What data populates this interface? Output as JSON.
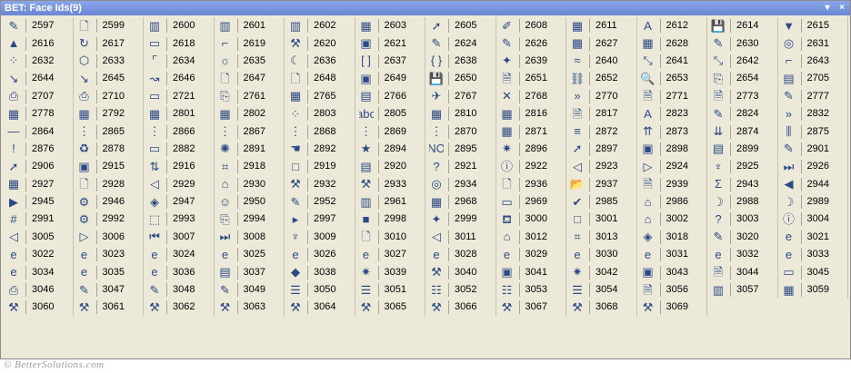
{
  "window": {
    "title": "BET: Face Ids(9)",
    "menu_glyph": "▾",
    "close_glyph": "×"
  },
  "footer": {
    "watermark": "© BetterSolutions.com"
  },
  "colors": {
    "titlebar": "#7a96df",
    "panel": "#ece9d8",
    "text": "#000000"
  },
  "grid": {
    "columns": 12,
    "cells": [
      {
        "id": "2597",
        "icon": "form-check-icon",
        "g": "✎"
      },
      {
        "id": "2599",
        "icon": "blank-page-icon",
        "g": "🗋"
      },
      {
        "id": "2600",
        "icon": "barcode-icon",
        "g": "▥"
      },
      {
        "id": "2601",
        "icon": "barcode2-icon",
        "g": "▥"
      },
      {
        "id": "2602",
        "icon": "barcode3-icon",
        "g": "▥"
      },
      {
        "id": "2603",
        "icon": "picture-icon",
        "g": "▦"
      },
      {
        "id": "2605",
        "icon": "arrow-icon",
        "g": "➚"
      },
      {
        "id": "2608",
        "icon": "tool-icon",
        "g": "✐"
      },
      {
        "id": "2611",
        "icon": "calendar-icon",
        "g": "▦"
      },
      {
        "id": "2612",
        "icon": "font-color-icon",
        "g": "A"
      },
      {
        "id": "2614",
        "icon": "save-icon",
        "g": "💾"
      },
      {
        "id": "2615",
        "icon": "down-arrow-icon",
        "g": "▼"
      },
      {
        "id": "2616",
        "icon": "up-arrow-icon",
        "g": "▲"
      },
      {
        "id": "2617",
        "icon": "rotate-icon",
        "g": "↻"
      },
      {
        "id": "2618",
        "icon": "field-icon",
        "g": "▭"
      },
      {
        "id": "2619",
        "icon": "shape-icon",
        "g": "⌐"
      },
      {
        "id": "2620",
        "icon": "tools-icon",
        "g": "⚒"
      },
      {
        "id": "2621",
        "icon": "image-icon",
        "g": "▣"
      },
      {
        "id": "2624",
        "icon": "paint-icon",
        "g": "✎"
      },
      {
        "id": "2626",
        "icon": "draw-icon",
        "g": "✎"
      },
      {
        "id": "2627",
        "icon": "grid-icon",
        "g": "▦"
      },
      {
        "id": "2628",
        "icon": "table-icon",
        "g": "▦"
      },
      {
        "id": "2630",
        "icon": "highlight-icon",
        "g": "✎"
      },
      {
        "id": "2631",
        "icon": "globe-icon",
        "g": "◎"
      },
      {
        "id": "2632",
        "icon": "scatter-icon",
        "g": "⁘"
      },
      {
        "id": "2633",
        "icon": "shape2-icon",
        "g": "⬡"
      },
      {
        "id": "2634",
        "icon": "rect-corners-icon",
        "g": "⌜"
      },
      {
        "id": "2635",
        "icon": "sun-icon",
        "g": "☼"
      },
      {
        "id": "2636",
        "icon": "moon-icon",
        "g": "☾"
      },
      {
        "id": "2637",
        "icon": "brackets-icon",
        "g": "[ ]"
      },
      {
        "id": "2638",
        "icon": "braces-icon",
        "g": "{ }"
      },
      {
        "id": "2639",
        "icon": "star-icon",
        "g": "✦"
      },
      {
        "id": "2640",
        "icon": "wave-icon",
        "g": "≈"
      },
      {
        "id": "2641",
        "icon": "connector-icon",
        "g": "⤡"
      },
      {
        "id": "2642",
        "icon": "connector2-icon",
        "g": "⤡"
      },
      {
        "id": "2643",
        "icon": "elbow-icon",
        "g": "⌐"
      },
      {
        "id": "2644",
        "icon": "elbow2-icon",
        "g": "↘"
      },
      {
        "id": "2645",
        "icon": "elbow3-icon",
        "g": "↘"
      },
      {
        "id": "2646",
        "icon": "curve-icon",
        "g": "↝"
      },
      {
        "id": "2647",
        "icon": "page-add-icon",
        "g": "🗋"
      },
      {
        "id": "2648",
        "icon": "page-icon",
        "g": "🗋"
      },
      {
        "id": "2649",
        "icon": "photo-icon",
        "g": "▣"
      },
      {
        "id": "2650",
        "icon": "disk-icon",
        "g": "💾"
      },
      {
        "id": "2651",
        "icon": "doc-edit-icon",
        "g": "🗎"
      },
      {
        "id": "2652",
        "icon": "link-icon",
        "g": "⛓"
      },
      {
        "id": "2653",
        "icon": "search-icon",
        "g": "🔍"
      },
      {
        "id": "2654",
        "icon": "copy-icon",
        "g": "⎘"
      },
      {
        "id": "2705",
        "icon": "folder-icon",
        "g": "▤"
      },
      {
        "id": "2707",
        "icon": "printer-icon",
        "g": "⎙"
      },
      {
        "id": "2710",
        "icon": "printer2-icon",
        "g": "⎙"
      },
      {
        "id": "2721",
        "icon": "form-icon",
        "g": "▭"
      },
      {
        "id": "2761",
        "icon": "pages-icon",
        "g": "⎘"
      },
      {
        "id": "2765",
        "icon": "table2-icon",
        "g": "▦"
      },
      {
        "id": "2766",
        "icon": "sheet-icon",
        "g": "▤"
      },
      {
        "id": "2767",
        "icon": "airplane-icon",
        "g": "✈"
      },
      {
        "id": "2768",
        "icon": "cross-icon",
        "g": "✕"
      },
      {
        "id": "2770",
        "icon": "chevron-right-icon",
        "g": "»"
      },
      {
        "id": "2771",
        "icon": "note-icon",
        "g": "🗎"
      },
      {
        "id": "2773",
        "icon": "note2-icon",
        "g": "🗎"
      },
      {
        "id": "2777",
        "icon": "pencil-icon",
        "g": "✎"
      },
      {
        "id": "2778",
        "icon": "grid2-icon",
        "g": "▦"
      },
      {
        "id": "2792",
        "icon": "grid3-icon",
        "g": "▦"
      },
      {
        "id": "2801",
        "icon": "grid4-icon",
        "g": "▦"
      },
      {
        "id": "2802",
        "icon": "grid5-icon",
        "g": "▦"
      },
      {
        "id": "2803",
        "icon": "dots-icon",
        "g": "⁘"
      },
      {
        "id": "2805",
        "icon": "spell-icon",
        "g": "abc"
      },
      {
        "id": "2810",
        "icon": "chart-icon",
        "g": "▦"
      },
      {
        "id": "2816",
        "icon": "grid6-icon",
        "g": "▦"
      },
      {
        "id": "2817",
        "icon": "note3-icon",
        "g": "🗎"
      },
      {
        "id": "2823",
        "icon": "font-icon",
        "g": "A"
      },
      {
        "id": "2824",
        "icon": "pen-icon",
        "g": "✎"
      },
      {
        "id": "2832",
        "icon": "chevron-down-icon",
        "g": "»"
      },
      {
        "id": "2864",
        "icon": "line-icon",
        "g": "—"
      },
      {
        "id": "2865",
        "icon": "dotted-grid-icon",
        "g": "⋮"
      },
      {
        "id": "2866",
        "icon": "dotted-grid2-icon",
        "g": "⋮"
      },
      {
        "id": "2867",
        "icon": "dotted-grid3-icon",
        "g": "⋮"
      },
      {
        "id": "2868",
        "icon": "dotted-grid4-icon",
        "g": "⋮"
      },
      {
        "id": "2869",
        "icon": "dotted-grid5-icon",
        "g": "⋮"
      },
      {
        "id": "2870",
        "icon": "dotted-grid6-icon",
        "g": "⋮"
      },
      {
        "id": "2871",
        "icon": "grid7-icon",
        "g": "▦"
      },
      {
        "id": "2872",
        "icon": "align-icon",
        "g": "≡"
      },
      {
        "id": "2873",
        "icon": "arrows-up-icon",
        "g": "⇈"
      },
      {
        "id": "2874",
        "icon": "arrows-down-icon",
        "g": "⇊"
      },
      {
        "id": "2875",
        "icon": "bars-icon",
        "g": "⫼"
      },
      {
        "id": "2876",
        "icon": "exclaim-icon",
        "g": "!"
      },
      {
        "id": "2878",
        "icon": "recycle-icon",
        "g": "♻"
      },
      {
        "id": "2882",
        "icon": "presentation-icon",
        "g": "▭"
      },
      {
        "id": "2891",
        "icon": "rocket-icon",
        "g": "✺"
      },
      {
        "id": "2892",
        "icon": "hand-icon",
        "g": "☚"
      },
      {
        "id": "2894",
        "icon": "star-doc-icon",
        "g": "★"
      },
      {
        "id": "2895",
        "icon": "no-icon-icon",
        "g": "NO"
      },
      {
        "id": "2896",
        "icon": "sparkle-icon",
        "g": "✷"
      },
      {
        "id": "2897",
        "icon": "cursor-icon",
        "g": "➚"
      },
      {
        "id": "2898",
        "icon": "card-icon",
        "g": "▣"
      },
      {
        "id": "2899",
        "icon": "doc-lines-icon",
        "g": "▤"
      },
      {
        "id": "2901",
        "icon": "eraser-icon",
        "g": "✎"
      },
      {
        "id": "2906",
        "icon": "pointer-icon",
        "g": "➚"
      },
      {
        "id": "2915",
        "icon": "save2-icon",
        "g": "▣"
      },
      {
        "id": "2916",
        "icon": "sort-az-icon",
        "g": "⇅"
      },
      {
        "id": "2918",
        "icon": "selector-icon",
        "g": "⌗"
      },
      {
        "id": "2919",
        "icon": "square-icon",
        "g": "□"
      },
      {
        "id": "2920",
        "icon": "edit-box-icon",
        "g": "▤"
      },
      {
        "id": "2921",
        "icon": "help-box-icon",
        "g": "?"
      },
      {
        "id": "2922",
        "icon": "info-box-icon",
        "g": "ⓘ"
      },
      {
        "id": "2923",
        "icon": "left-box-icon",
        "g": "◁"
      },
      {
        "id": "2924",
        "icon": "right-box-icon",
        "g": "▷"
      },
      {
        "id": "2925",
        "icon": "trophy-icon",
        "g": "♆"
      },
      {
        "id": "2926",
        "icon": "skip-icon",
        "g": "⏭"
      },
      {
        "id": "2927",
        "icon": "grid8-icon",
        "g": "▦"
      },
      {
        "id": "2928",
        "icon": "doc2-icon",
        "g": "🗋"
      },
      {
        "id": "2929",
        "icon": "back-box-icon",
        "g": "◁"
      },
      {
        "id": "2930",
        "icon": "hat-icon",
        "g": "⌂"
      },
      {
        "id": "2932",
        "icon": "tools2-icon",
        "g": "⚒"
      },
      {
        "id": "2933",
        "icon": "tools3-icon",
        "g": "⚒"
      },
      {
        "id": "2934",
        "icon": "globe2-icon",
        "g": "◎"
      },
      {
        "id": "2936",
        "icon": "doc3-icon",
        "g": "🗋"
      },
      {
        "id": "2937",
        "icon": "folder2-icon",
        "g": "📂"
      },
      {
        "id": "2939",
        "icon": "note4-icon",
        "g": "🗎"
      },
      {
        "id": "2943",
        "icon": "sigma-icon",
        "g": "Σ"
      },
      {
        "id": "2944",
        "icon": "triangle-left-icon",
        "g": "◀"
      },
      {
        "id": "2945",
        "icon": "triangle-right-icon",
        "g": "▶"
      },
      {
        "id": "2946",
        "icon": "gear-icon",
        "g": "⚙"
      },
      {
        "id": "2947",
        "icon": "fill-icon",
        "g": "◈"
      },
      {
        "id": "2950",
        "icon": "smiley-icon",
        "g": "☺"
      },
      {
        "id": "2952",
        "icon": "form2-icon",
        "g": "✎"
      },
      {
        "id": "2961",
        "icon": "chart2-icon",
        "g": "▥"
      },
      {
        "id": "2968",
        "icon": "grid9-icon",
        "g": "▦"
      },
      {
        "id": "2969",
        "icon": "presentation2-icon",
        "g": "▭"
      },
      {
        "id": "2985",
        "icon": "check-icon",
        "g": "✔"
      },
      {
        "id": "2986",
        "icon": "house-icon",
        "g": "⌂"
      },
      {
        "id": "2988",
        "icon": "banana-icon",
        "g": "☽"
      },
      {
        "id": "2989",
        "icon": "banana2-icon",
        "g": "☽"
      },
      {
        "id": "2991",
        "icon": "hash-icon",
        "g": "#"
      },
      {
        "id": "2992",
        "icon": "gear2-icon",
        "g": "⚙"
      },
      {
        "id": "2993",
        "icon": "dotted-shape-icon",
        "g": "⬚"
      },
      {
        "id": "2994",
        "icon": "pages2-icon",
        "g": "⎘"
      },
      {
        "id": "2997",
        "icon": "play-icon",
        "g": "▸"
      },
      {
        "id": "2998",
        "icon": "stop-icon",
        "g": "■"
      },
      {
        "id": "2999",
        "icon": "pin-icon",
        "g": "✦"
      },
      {
        "id": "3000",
        "icon": "easel-icon",
        "g": "⛾"
      },
      {
        "id": "3001",
        "icon": "blank-box-icon",
        "g": "□"
      },
      {
        "id": "3002",
        "icon": "house2-icon",
        "g": "⌂"
      },
      {
        "id": "3003",
        "icon": "help-box2-icon",
        "g": "?"
      },
      {
        "id": "3004",
        "icon": "info-box2-icon",
        "g": "ⓘ"
      },
      {
        "id": "3005",
        "icon": "left-box2-icon",
        "g": "◁"
      },
      {
        "id": "3006",
        "icon": "right-box2-icon",
        "g": "▷"
      },
      {
        "id": "3007",
        "icon": "skip2-icon",
        "g": "⏮"
      },
      {
        "id": "3008",
        "icon": "skip3-icon",
        "g": "⏭"
      },
      {
        "id": "3009",
        "icon": "cup-icon",
        "g": "♆"
      },
      {
        "id": "3010",
        "icon": "doc4-icon",
        "g": "🗋"
      },
      {
        "id": "3011",
        "icon": "back-box2-icon",
        "g": "◁"
      },
      {
        "id": "3012",
        "icon": "hat2-icon",
        "g": "⌂"
      },
      {
        "id": "3013",
        "icon": "selector2-icon",
        "g": "⌗"
      },
      {
        "id": "3018",
        "icon": "fill2-icon",
        "g": "◈"
      },
      {
        "id": "3020",
        "icon": "note5-icon",
        "g": "✎"
      },
      {
        "id": "3021",
        "icon": "ie-icon",
        "g": "e"
      },
      {
        "id": "3022",
        "icon": "ie2-icon",
        "g": "e"
      },
      {
        "id": "3023",
        "icon": "ie3-icon",
        "g": "e"
      },
      {
        "id": "3024",
        "icon": "ie4-icon",
        "g": "e"
      },
      {
        "id": "3025",
        "icon": "ie5-icon",
        "g": "e"
      },
      {
        "id": "3026",
        "icon": "ie6-icon",
        "g": "e"
      },
      {
        "id": "3027",
        "icon": "ie7-icon",
        "g": "e"
      },
      {
        "id": "3028",
        "icon": "ie8-icon",
        "g": "e"
      },
      {
        "id": "3029",
        "icon": "ie9-icon",
        "g": "e"
      },
      {
        "id": "3030",
        "icon": "ie10-icon",
        "g": "e"
      },
      {
        "id": "3031",
        "icon": "ie11-icon",
        "g": "e"
      },
      {
        "id": "3032",
        "icon": "ie12-icon",
        "g": "e"
      },
      {
        "id": "3033",
        "icon": "ie13-icon",
        "g": "e"
      },
      {
        "id": "3034",
        "icon": "ie14-icon",
        "g": "e"
      },
      {
        "id": "3035",
        "icon": "ie15-icon",
        "g": "e"
      },
      {
        "id": "3036",
        "icon": "ie16-icon",
        "g": "e"
      },
      {
        "id": "3037",
        "icon": "form3-icon",
        "g": "▤"
      },
      {
        "id": "3038",
        "icon": "shapes-icon",
        "g": "◆"
      },
      {
        "id": "3039",
        "icon": "sparkle2-icon",
        "g": "✷"
      },
      {
        "id": "3040",
        "icon": "tools4-icon",
        "g": "⚒"
      },
      {
        "id": "3041",
        "icon": "image2-icon",
        "g": "▣"
      },
      {
        "id": "3042",
        "icon": "doc-star-icon",
        "g": "✷"
      },
      {
        "id": "3043",
        "icon": "photo2-icon",
        "g": "▣"
      },
      {
        "id": "3044",
        "icon": "doc5-icon",
        "g": "🗎"
      },
      {
        "id": "3045",
        "icon": "window-icon",
        "g": "▭"
      },
      {
        "id": "3046",
        "icon": "printer3-icon",
        "g": "⎙"
      },
      {
        "id": "3047",
        "icon": "brush-icon",
        "g": "✎"
      },
      {
        "id": "3048",
        "icon": "paint2-icon",
        "g": "✎"
      },
      {
        "id": "3049",
        "icon": "tag-icon",
        "g": "✎"
      },
      {
        "id": "3050",
        "icon": "split-icon",
        "g": "☰"
      },
      {
        "id": "3051",
        "icon": "split2-icon",
        "g": "☰"
      },
      {
        "id": "3052",
        "icon": "blocks-icon",
        "g": "☷"
      },
      {
        "id": "3053",
        "icon": "blocks2-icon",
        "g": "☷"
      },
      {
        "id": "3054",
        "icon": "lines-icon",
        "g": "☰"
      },
      {
        "id": "3056",
        "icon": "doc-arrow-icon",
        "g": "🗎"
      },
      {
        "id": "3057",
        "icon": "chart-bars-icon",
        "g": "▥"
      },
      {
        "id": "3059",
        "icon": "calendar2-icon",
        "g": "▦"
      },
      {
        "id": "3060",
        "icon": "tools5-icon",
        "g": "⚒"
      },
      {
        "id": "3061",
        "icon": "tools6-icon",
        "g": "⚒"
      },
      {
        "id": "3062",
        "icon": "tools7-icon",
        "g": "⚒"
      },
      {
        "id": "3063",
        "icon": "tools8-icon",
        "g": "⚒"
      },
      {
        "id": "3064",
        "icon": "tools9-icon",
        "g": "⚒"
      },
      {
        "id": "3065",
        "icon": "tools10-icon",
        "g": "⚒"
      },
      {
        "id": "3066",
        "icon": "tools11-icon",
        "g": "⚒"
      },
      {
        "id": "3067",
        "icon": "tools12-icon",
        "g": "⚒"
      },
      {
        "id": "3068",
        "icon": "tools13-icon",
        "g": "⚒"
      },
      {
        "id": "3069",
        "icon": "tools14-icon",
        "g": "⚒"
      }
    ]
  }
}
